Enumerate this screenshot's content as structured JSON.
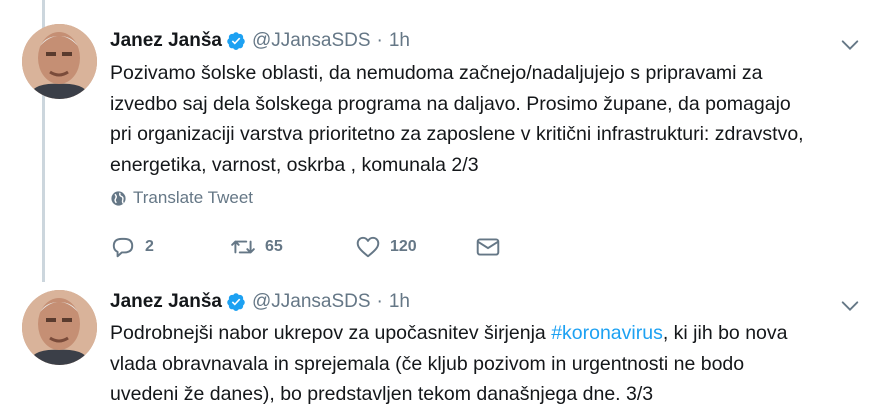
{
  "tweets": [
    {
      "author": {
        "name": "Janez Janša",
        "handle": "@JJansaSDS"
      },
      "separator": "·",
      "time": "1h",
      "text_lines": [
        "Pozivamo šolske oblasti, da nemudoma začnejo/nadaljujejo s pripravami za",
        "izvedbo  saj dela šolskega programa na daljavo. Prosimo župane, da pomagajo",
        "pri organizaciji varstva prioritetno za zaposlene v kritični infrastrukturi: zdravstvo,",
        "energetika, varnost, oskrba , komunala 2/3"
      ],
      "translate_label": "Translate Tweet",
      "actions": {
        "replies": "2",
        "retweets": "65",
        "likes": "120"
      }
    },
    {
      "author": {
        "name": "Janez Janša",
        "handle": "@JJansaSDS"
      },
      "separator": "·",
      "time": "1h",
      "text_line1_pre": "Podrobnejši nabor ukrepov za upočasnitev širjenja ",
      "hashtag": "#koronavirus",
      "text_line1_post": ", ki jih bo nova",
      "text_lines_rest": [
        "vlada obravnavala in sprejemala (če kljub pozivom in urgentnosti ne bodo",
        "uvedeni že danes), bo predstavljen tekom današnjega dne. 3/3"
      ]
    }
  ],
  "colors": {
    "verified": "#1da1f2",
    "hashtag": "#1da1f2",
    "muted": "#657786",
    "thread_line": "#ccd6dd"
  },
  "icons": {
    "verified": "verified-badge-icon",
    "chevron": "chevron-down-icon",
    "globe": "globe-icon",
    "reply": "reply-icon",
    "retweet": "retweet-icon",
    "like": "heart-icon",
    "dm": "envelope-icon"
  }
}
